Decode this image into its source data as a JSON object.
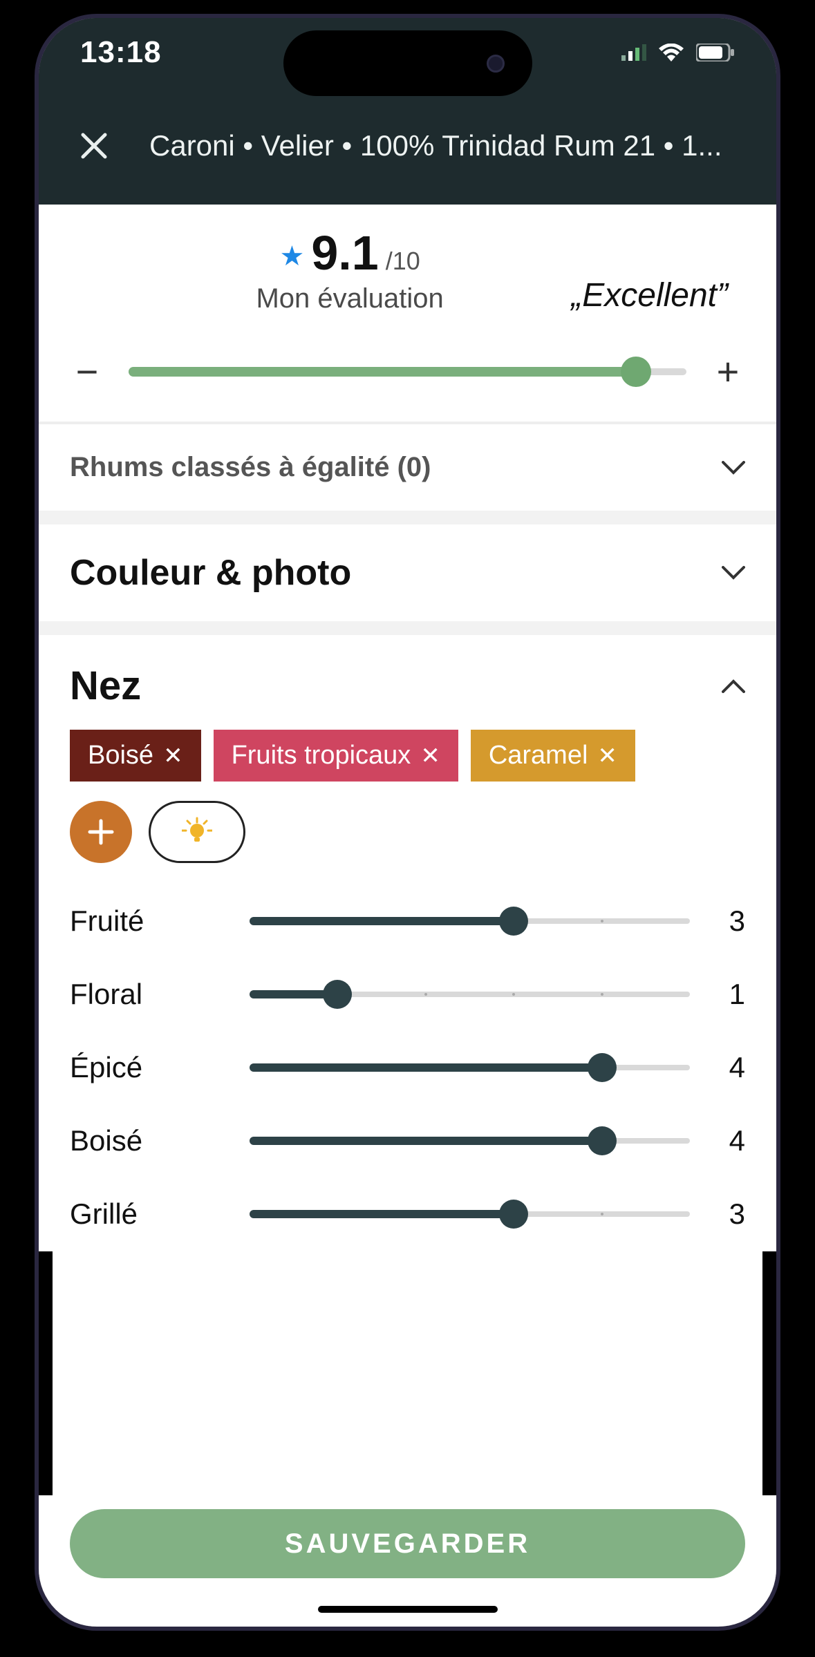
{
  "status": {
    "time": "13:18"
  },
  "header": {
    "title": "Caroni • Velier • 100% Trinidad Rum 21 • 1..."
  },
  "rating": {
    "score": "9.1",
    "out_of": "/10",
    "subtitle": "Mon évaluation",
    "word": "„Excellent”",
    "minus": "−",
    "plus": "+",
    "fill_pct": 91
  },
  "tied": {
    "label": "Rhums classés à égalité (0)"
  },
  "color_section": {
    "title": "Couleur & photo"
  },
  "nose": {
    "title": "Nez",
    "tags": [
      {
        "label": "Boisé",
        "cls": "t1"
      },
      {
        "label": "Fruits tropicaux",
        "cls": "t2"
      },
      {
        "label": "Caramel",
        "cls": "t3"
      }
    ],
    "attributes": [
      {
        "name": "Fruité",
        "value": 3,
        "max": 5
      },
      {
        "name": "Floral",
        "value": 1,
        "max": 5
      },
      {
        "name": "Épicé",
        "value": 4,
        "max": 5
      },
      {
        "name": "Boisé",
        "value": 4,
        "max": 5
      },
      {
        "name": "Grillé",
        "value": 3,
        "max": 5
      }
    ]
  },
  "footer": {
    "save": "SAUVEGARDER"
  }
}
